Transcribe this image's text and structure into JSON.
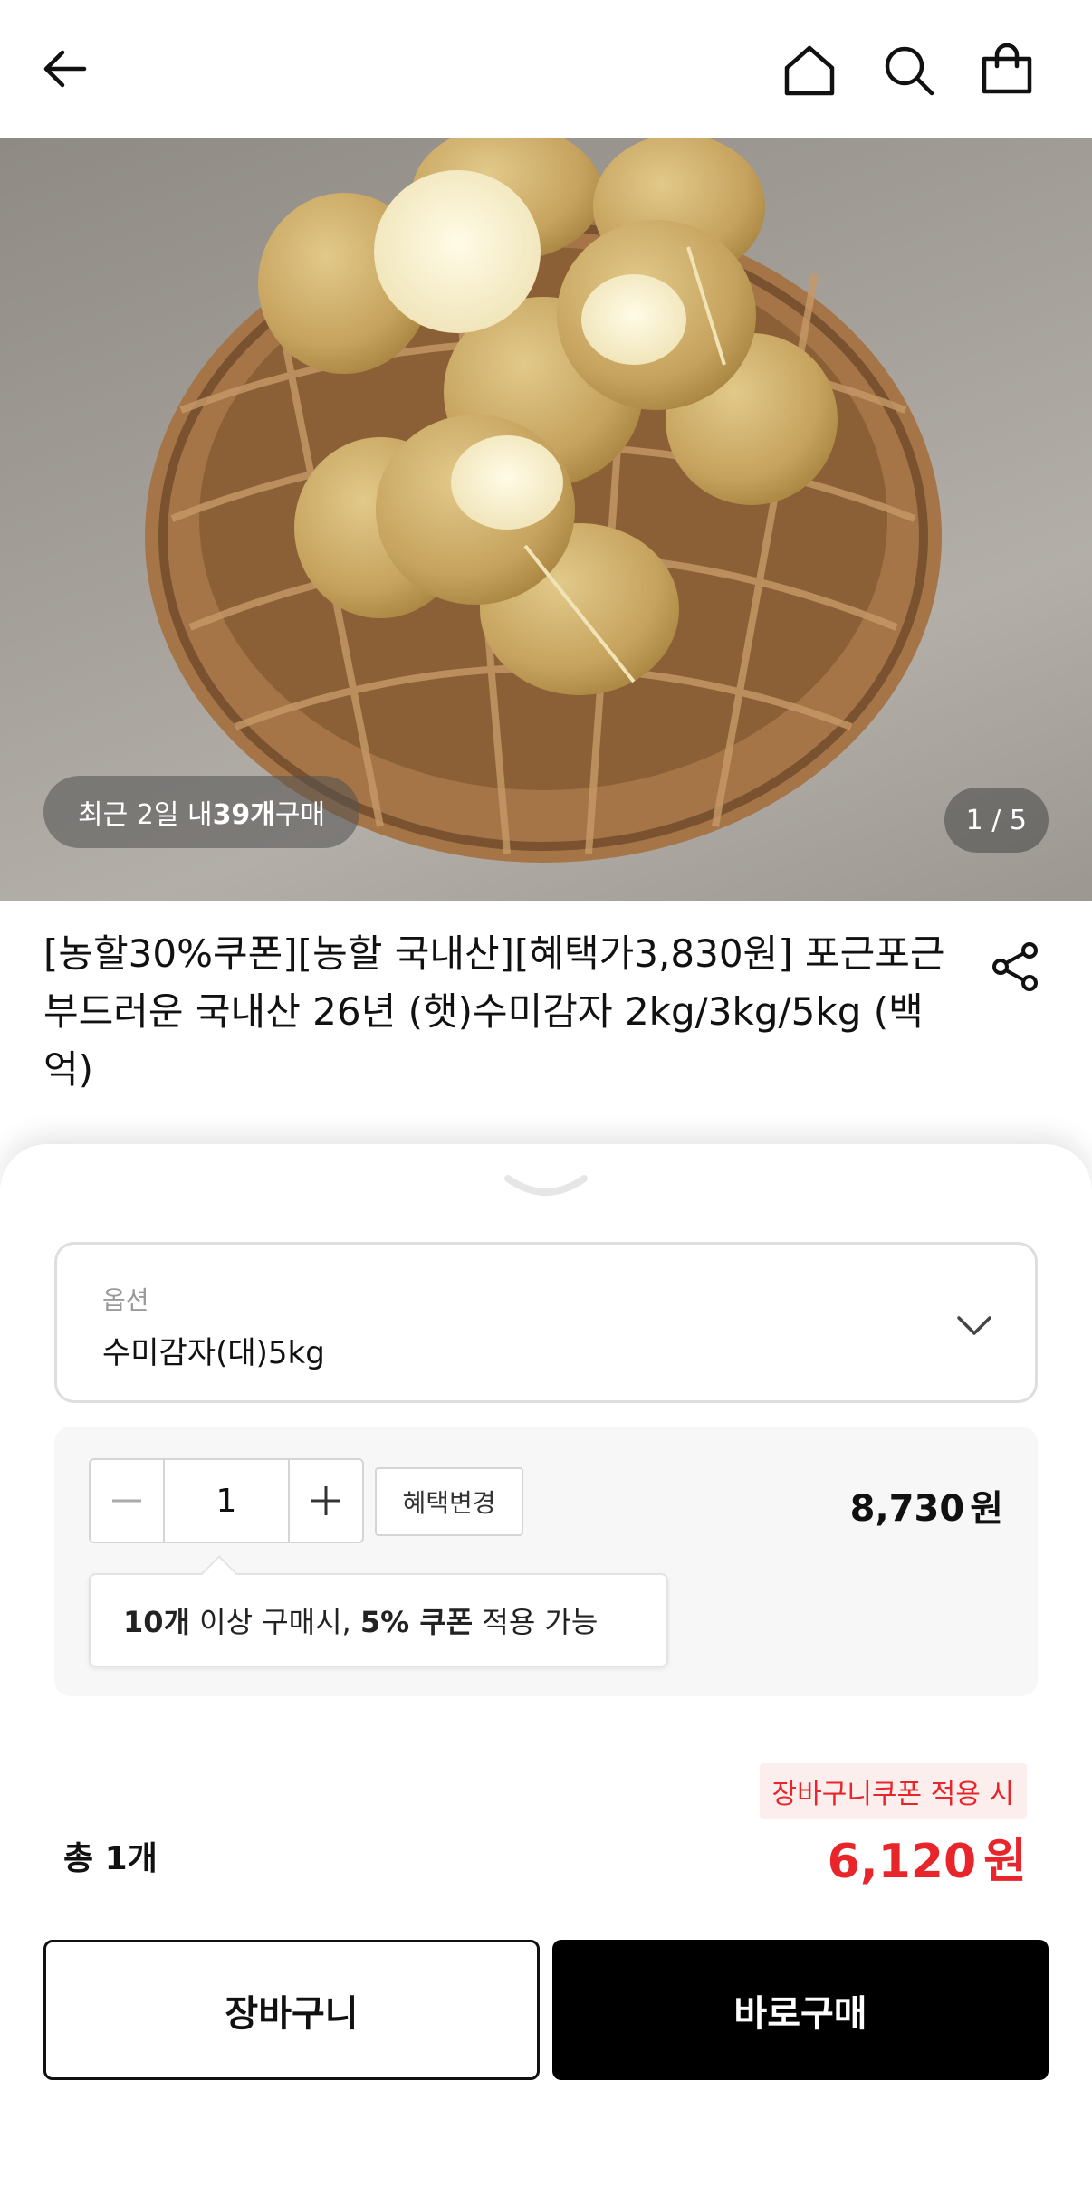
{
  "nav": {
    "icons": [
      "arrow-left-icon",
      "home-icon",
      "search-icon",
      "shopping-bag-icon"
    ]
  },
  "hero": {
    "purchase_prefix": "최근 2일 내 ",
    "purchase_count": "39개",
    "purchase_suffix": " 구매",
    "page_indicator": "1 / 5"
  },
  "product": {
    "title": "[농할30%쿠폰][농할 국내산][혜택가3,830원] 포근포근 부드러운 국내산 26년 (햇)수미감자 2kg/3kg/5kg (백억)"
  },
  "option": {
    "label": "옵션",
    "selected": "수미감자(대)5kg"
  },
  "quantity": {
    "value": "1",
    "benefit_button": "혜택변경",
    "price": "8,730",
    "currency": "원"
  },
  "tooltip": {
    "count": "10개",
    "text1": " 이상 구매시, ",
    "coupon": "5% 쿠폰",
    "text2": " 적용 가능"
  },
  "summary": {
    "coupon_tag": "장바구니쿠폰 적용 시",
    "total_label": "총 1개",
    "total_price": "6,120",
    "currency": "원"
  },
  "actions": {
    "cart_label": "장바구니",
    "buy_label": "바로구매"
  },
  "colors": {
    "accent_red": "#e8252a",
    "buy_button": "#000000",
    "coupon_bg": "#fdeeee"
  }
}
